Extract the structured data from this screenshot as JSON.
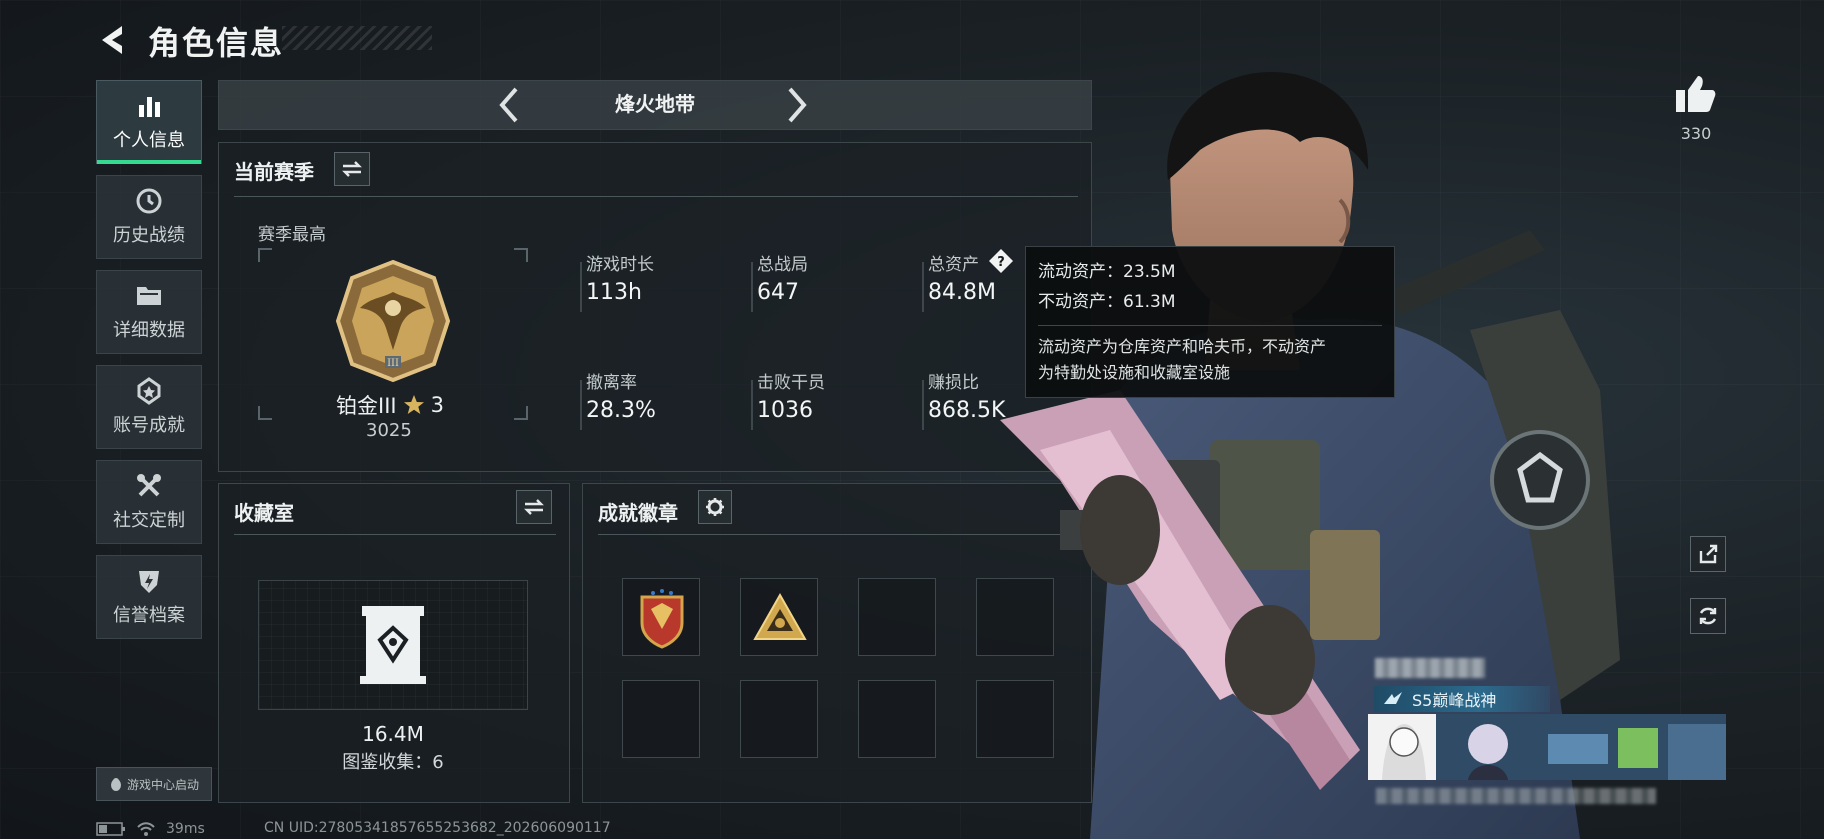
{
  "header": {
    "title": "角色信息"
  },
  "sidebar": {
    "items": [
      {
        "label": "个人信息",
        "icon": "bar-chart-icon",
        "active": true
      },
      {
        "label": "历史战绩",
        "icon": "clock-icon",
        "active": false
      },
      {
        "label": "详细数据",
        "icon": "folder-icon",
        "active": false
      },
      {
        "label": "账号成就",
        "icon": "medal-icon",
        "active": false
      },
      {
        "label": "社交定制",
        "icon": "tools-icon",
        "active": false
      },
      {
        "label": "信誉档案",
        "icon": "shield-bolt-icon",
        "active": false
      }
    ],
    "launch_label": "游戏中心启动"
  },
  "mode": {
    "name": "烽火地带"
  },
  "season": {
    "title": "当前赛季",
    "best_label": "赛季最高",
    "rank_name": "铂金III",
    "rank_stars": "3",
    "rank_score": "3025",
    "stats": [
      {
        "label": "游戏时长",
        "value": "113h"
      },
      {
        "label": "总战局",
        "value": "647"
      },
      {
        "label": "总资产",
        "value": "84.8M"
      },
      {
        "label": "撤离率",
        "value": "28.3%"
      },
      {
        "label": "击败干员",
        "value": "1036"
      },
      {
        "label": "赚损比",
        "value": "868.5K"
      }
    ]
  },
  "tooltip": {
    "liquid": "流动资产：23.5M",
    "fixed": "不动资产：61.3M",
    "desc_line1": "流动资产为仓库资产和哈夫币，不动资产",
    "desc_line2": "为特勤处设施和收藏室设施"
  },
  "collection": {
    "title": "收藏室",
    "value": "16.4M",
    "catalog": "图鉴收集：6"
  },
  "achievements": {
    "title": "成就徽章"
  },
  "profile": {
    "likes": "330",
    "title_tag": "S5巅峰战神"
  },
  "status": {
    "ping": "39ms",
    "uid": "CN UID:27805341857655253682_202606090117"
  },
  "colors": {
    "accent_green": "#35d98f",
    "tag_blue": "#2b6a8c",
    "rank_gold": "#c9a45a"
  }
}
